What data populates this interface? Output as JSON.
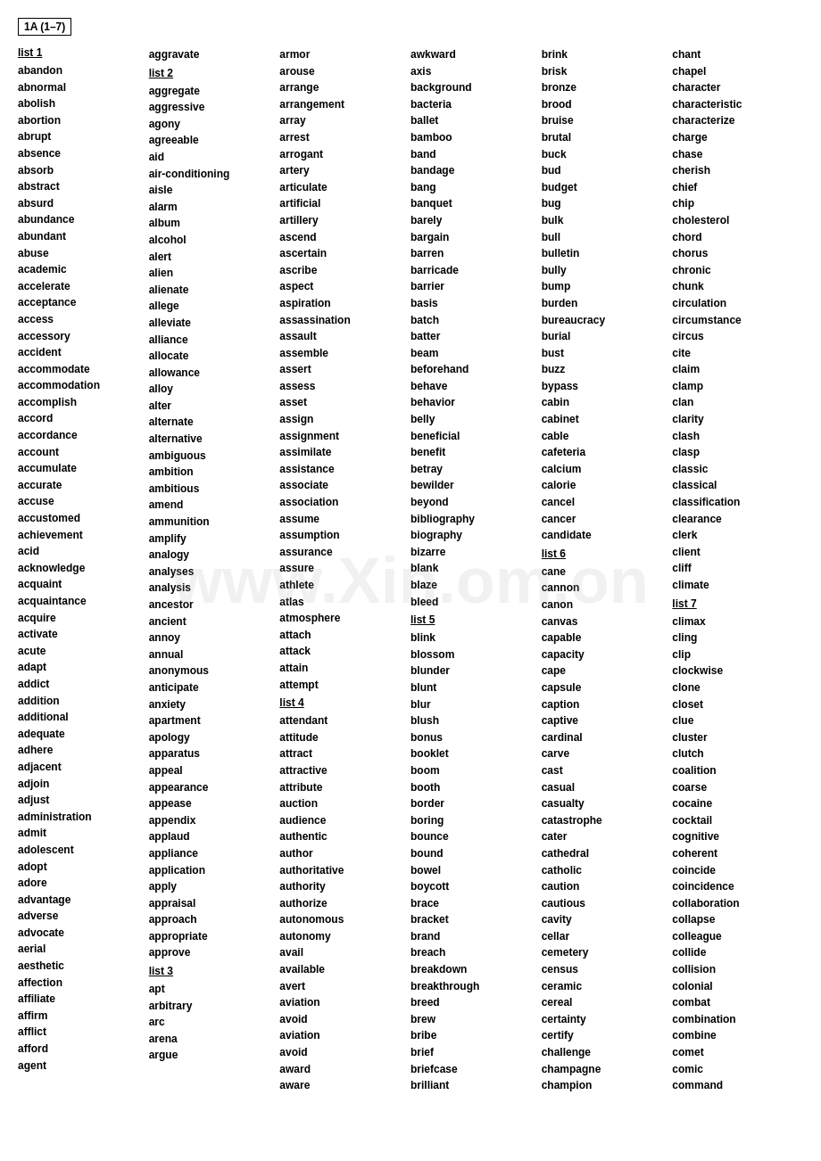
{
  "header": {
    "box_label": "1A (1–7)",
    "list1_label": "list 1",
    "list2_label": "list 2",
    "list3_label": "list 3",
    "list4_label": "list 4",
    "list5_label": "list 5",
    "list6_label": "list 6",
    "list7_label": "list 7"
  },
  "col1": [
    "abandon",
    "abnormal",
    "abolish",
    "abortion",
    "abrupt",
    "absence",
    "absorb",
    "abstract",
    "absurd",
    "abundance",
    "abundant",
    "abuse",
    "academic",
    "accelerate",
    "acceptance",
    "access",
    "accessory",
    "accident",
    "accommodate",
    "accommodation",
    "accomplish",
    "accord",
    "accordance",
    "account",
    "accumulate",
    "accurate",
    "accuse",
    "accustomed",
    "achievement",
    "acid",
    "acknowledge",
    "acquaint",
    "acquaintance",
    "acquire",
    "activate",
    "acute",
    "adapt",
    "addict",
    "addition",
    "additional",
    "adequate",
    "adhere",
    "adjacent",
    "adjoin",
    "adjust",
    "administration",
    "admit",
    "adolescent",
    "adopt",
    "adore",
    "advantage",
    "adverse",
    "advocate",
    "aerial",
    "aesthetic",
    "affection",
    "affiliate",
    "affirm",
    "afflict",
    "afford",
    "agent"
  ],
  "col2_header": "aggravate",
  "col2_pre_list2": [
    "aggravate"
  ],
  "col2": [
    "aggregate",
    "aggressive",
    "agony",
    "agreeable",
    "aid",
    "air-conditioning",
    "aisle",
    "alarm",
    "album",
    "alcohol",
    "alert",
    "alien",
    "alienate",
    "allege",
    "alleviate",
    "alliance",
    "allocate",
    "allowance",
    "alloy",
    "alter",
    "alternate",
    "alternative",
    "ambiguous",
    "ambition",
    "ambitious",
    "amend",
    "ammunition",
    "amplify",
    "analogy",
    "analyses",
    "analysis",
    "ancestor",
    "ancient",
    "annoy",
    "annual",
    "anonymous",
    "anticipate",
    "anxiety",
    "apartment",
    "apology",
    "apparatus",
    "appeal",
    "appearance",
    "appease",
    "appendix",
    "applaud",
    "appliance",
    "application",
    "apply",
    "appraisal",
    "approach",
    "appropriate",
    "approve"
  ],
  "col2_list3": [
    "apt",
    "arbitrary",
    "arc",
    "arena",
    "argue"
  ],
  "col3_pre": [
    "armor",
    "arouse",
    "arrange",
    "arrangement"
  ],
  "col3": [
    "array",
    "arrest",
    "arrogant",
    "artery",
    "articulate",
    "artificial",
    "artillery",
    "ascend",
    "ascertain",
    "ascribe",
    "aspect",
    "aspiration",
    "assassination",
    "assault",
    "assemble",
    "assert",
    "assess",
    "asset",
    "assign",
    "assignment",
    "assimilate",
    "assistance",
    "associate",
    "association",
    "assume",
    "assumption",
    "assurance",
    "assure",
    "athlete",
    "atlas",
    "atmosphere",
    "attach",
    "attack",
    "attain",
    "attempt"
  ],
  "col3_list4": [
    "attendant",
    "attitude",
    "attract",
    "attractive",
    "attribute",
    "auction",
    "audience",
    "authentic",
    "author",
    "authoritative",
    "authority",
    "authorize",
    "autonomous",
    "autonomy",
    "avail",
    "available",
    "avert",
    "aviation",
    "avoid",
    "aviation",
    "avoid",
    "award",
    "aware"
  ],
  "col4": [
    "awkward",
    "axis",
    "background",
    "bacteria",
    "ballet",
    "bamboo",
    "band",
    "bandage",
    "bang",
    "banquet",
    "barely",
    "bargain",
    "barren",
    "barricade",
    "barrier",
    "basis",
    "batch",
    "batter",
    "beam",
    "beforehand",
    "behave",
    "behavior",
    "belly",
    "beneficial",
    "benefit",
    "betray",
    "bewilder",
    "beyond",
    "bibliography",
    "biography",
    "bizarre",
    "blank",
    "blaze",
    "bleed"
  ],
  "col4_list5": [
    "blink",
    "blossom",
    "blunder",
    "blunt",
    "blur",
    "blush",
    "bonus",
    "booklet",
    "boom",
    "booth",
    "border",
    "boring",
    "bounce",
    "bound",
    "bowel",
    "boycott",
    "brace",
    "bracket",
    "brand",
    "breach",
    "breakdown",
    "breakthrough",
    "breed",
    "brew",
    "bribe",
    "brief",
    "briefcase",
    "brilliant"
  ],
  "col5_pre": [
    "brink",
    "brisk",
    "bronze",
    "brood",
    "bruise",
    "brutal",
    "buck",
    "bud",
    "budget",
    "bug",
    "bulk",
    "bull",
    "bulletin",
    "bully",
    "bump",
    "burden",
    "bureaucracy",
    "burial",
    "bust",
    "buzz",
    "bypass",
    "cabin",
    "cabinet",
    "cable",
    "cafeteria",
    "calcium",
    "calorie",
    "cancel",
    "cancer",
    "candidate"
  ],
  "col5_list6": [
    "cane",
    "cannon",
    "canon",
    "canvas",
    "capable",
    "capacity",
    "cape",
    "capsule",
    "caption",
    "captive",
    "cardinal",
    "carve",
    "cast",
    "casual",
    "casualty",
    "catastrophe",
    "cater",
    "cathedral",
    "catholic",
    "caution",
    "cautious",
    "cavity",
    "cellar",
    "cemetery",
    "census",
    "ceramic",
    "cereal",
    "certainty",
    "certify",
    "challenge",
    "champagne",
    "champion"
  ],
  "col6": [
    "chant",
    "chapel",
    "character",
    "characteristic",
    "characterize",
    "charge",
    "chase",
    "cherish",
    "chief",
    "chip",
    "cholesterol",
    "chord",
    "chorus",
    "chronic",
    "chunk",
    "circulation",
    "circumstance",
    "circus",
    "cite",
    "claim",
    "clamp",
    "clan",
    "clarity",
    "clash",
    "clasp",
    "classic",
    "classical",
    "classification",
    "clearance",
    "clerk",
    "client",
    "cliff",
    "climate"
  ],
  "col6_list7": [
    "climax",
    "cling",
    "clip",
    "clockwise",
    "clone",
    "closet",
    "clue",
    "cluster",
    "clutch",
    "coalition",
    "coarse",
    "cocaine",
    "cocktail",
    "cognitive",
    "coherent",
    "coincide",
    "coincidence",
    "collaboration",
    "collapse",
    "colleague",
    "collide",
    "collision",
    "colonial",
    "combat",
    "combination",
    "combine",
    "comet",
    "comic",
    "command"
  ]
}
